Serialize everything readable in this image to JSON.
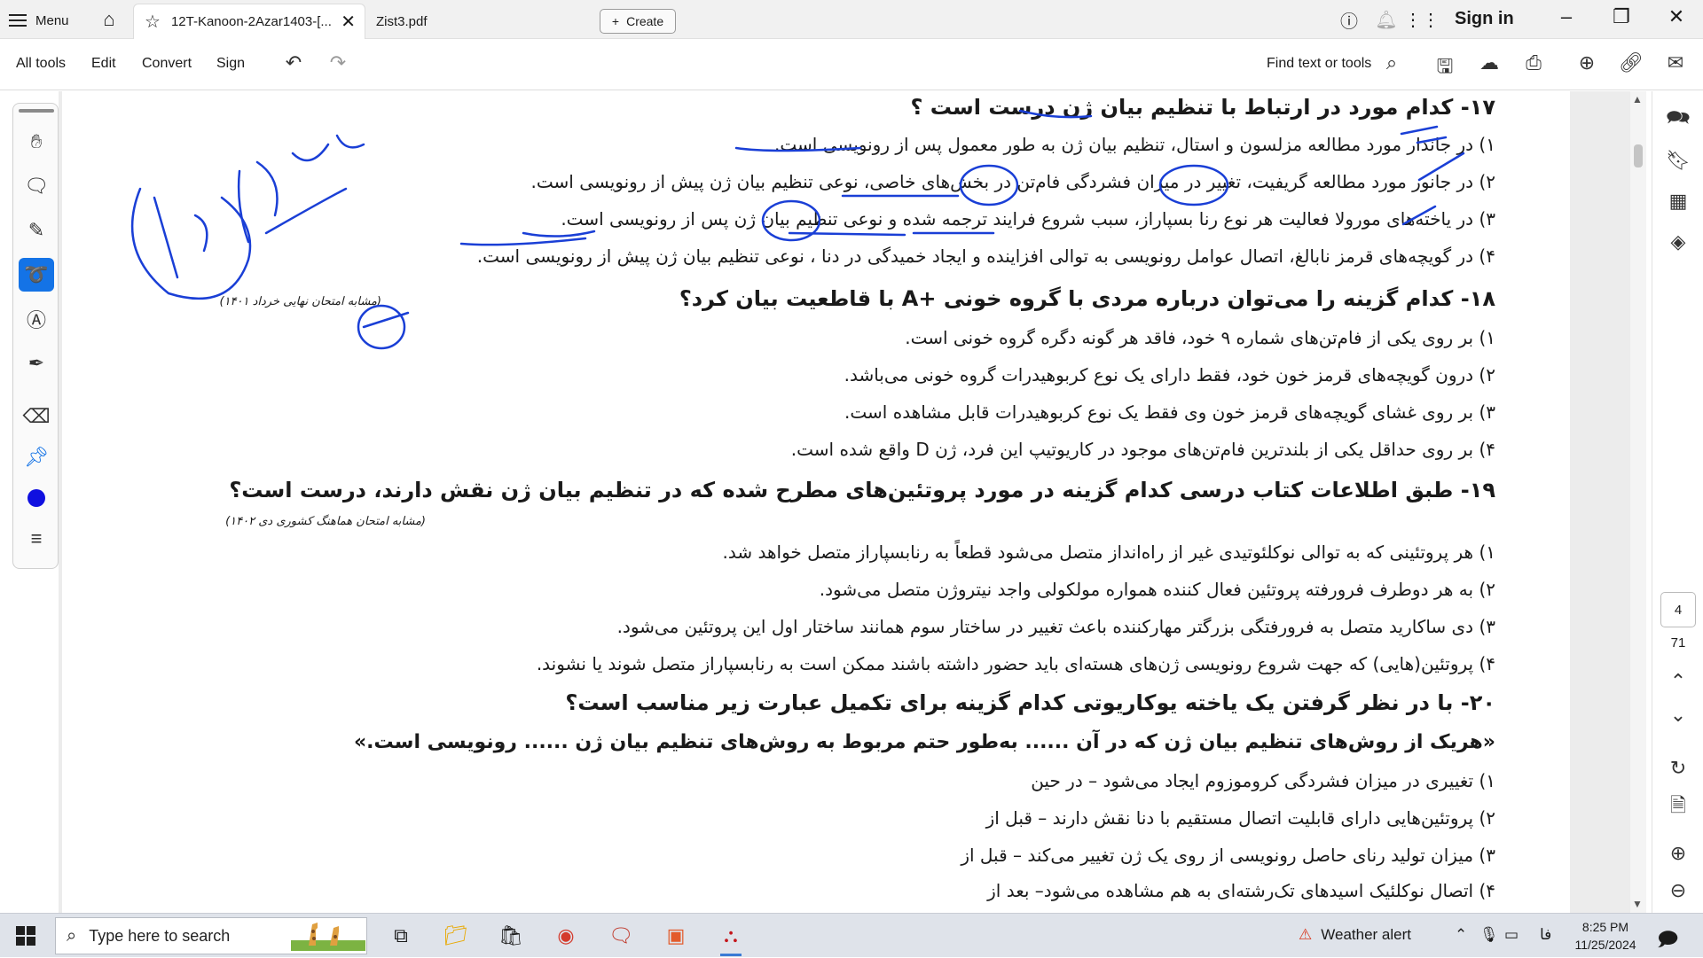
{
  "tabbar": {
    "menu_label": "Menu",
    "tabs": [
      {
        "label": "12T-Kanoon-2Azar1403-[..."
      },
      {
        "label": "Zist3.pdf"
      }
    ],
    "create_label": "Create",
    "sign_in_label": "Sign in"
  },
  "toolbar": {
    "all_tools": "All tools",
    "edit": "Edit",
    "convert": "Convert",
    "sign": "Sign",
    "find_label": "Find text or tools"
  },
  "document": {
    "q17": {
      "title": "۱۷- کدام مورد در ارتباط با تنظیم بیان ژن درست است ؟",
      "options": [
        "۱) در جاندار مورد مطالعه مزلسون و استال، تنظیم بیان ژن به طور معمول پس از رونویسی است.",
        "۲) در جانور مورد مطالعه گریفیت، تغییر در میزان فشردگی فام‌تن در بخش‌های خاصی، نوعی تنظیم بیان ژن پیش از رونویسی است.",
        "۳) در یاخته‌های مورولا  فعالیت هر نوع رنا بسپاراز، سبب شروع فرایند ترجمه شده و نوعی تنظیم بیان ژن پس از رونویسی است.",
        "۴) در گویچه‌های قرمز نابالغ، اتصال عوامل رونویسی به توالی افزاینده و ایجاد خمیدگی در دنا ، نوعی تنظیم بیان ژن پیش از رونویسی است."
      ]
    },
    "note1": "(مشابه امتحان نهایی خرداد ۱۴۰۱)",
    "q18": {
      "title": "۱۸- کدام گزینه را می‌توان درباره مردی با گروه خونی  +A با قاطعیت بیان کرد؟",
      "options": [
        "۱) بر روی یکی از فام‌تن‌های شماره ۹ خود، فاقد هر گونه دگره گروه خونی است.",
        "۲) درون گویچه‌های قرمز خون خود، فقط دارای یک نوع کربوهیدرات گروه خونی می‌باشد.",
        "۳) بر روی غشای گویچه‌های قرمز خون وی فقط یک نوع کربوهیدرات قابل مشاهده است.",
        "۴) بر روی حداقل یکی از بلندترین فام‌تن‌های موجود در کاریوتیپ این فرد، ژن D واقع شده است."
      ]
    },
    "q19": {
      "title": "۱۹- طبق اطلاعات کتاب درسی کدام گزینه در مورد پروتئین‌های مطرح شده که در تنظیم بیان ژن نقش دارند، درست است؟",
      "options": [
        "۱) هر پروتئینی که به توالی نوکلئوتیدی غیر از راه‌انداز متصل می‌شود قطعاً به رنابسپاراز متصل خواهد شد.",
        "۲) به هر دوطرف فرورفته پروتئین فعال کننده همواره مولکولی واجد نیتروژن متصل می‌شود.",
        "۳) دی ساکارید متصل به فرورفتگی بزرگتر مهارکننده باعث تغییر در ساختار سوم همانند ساختار اول این پروتئین می‌شود.",
        "۴) پروتئین(هایی) که جهت شروع رونویسی ژن‌های هسته‌ای باید حضور داشته باشند ممکن است به رنابسپاراز متصل شوند یا نشوند."
      ]
    },
    "note2": "(مشابه امتحان هماهنگ کشوری دی ۱۴۰۲)",
    "q20": {
      "title": "۲۰- با در نظر گرفتن یک یاخته یوکاریوتی کدام گزینه برای تکمیل عبارت زیر مناسب است؟",
      "quote": "«هریک از روش‌های تنظیم بیان ژن که در آن ...... به‌طور حتم مربوط به روش‌های تنظیم بیان ژن ...... رونویسی است.»",
      "options": [
        "۱) تغییری در میزان فشردگی کروموزوم ایجاد می‌شود – در حین",
        "۲) پروتئین‌هایی دارای قابلیت اتصال مستقیم با دنا نقش دارند – قبل از",
        "۳) میزان تولید رنای حاصل رونویسی از روی یک ژن تغییر می‌کند – قبل از",
        "۴) اتصال نوکلئیک اسیدهای تک‌رشته‌ای به هم مشاهده می‌شود– بعد از"
      ]
    }
  },
  "page_nav": {
    "current": "4",
    "total": "71"
  },
  "taskbar": {
    "search_placeholder": "Type here to search",
    "weather": "Weather alert",
    "lang": "فا",
    "time": "8:25 PM",
    "date": "11/25/2024"
  },
  "colors": {
    "ink_blue": "#1a3fd6",
    "accent": "#1473e6"
  }
}
